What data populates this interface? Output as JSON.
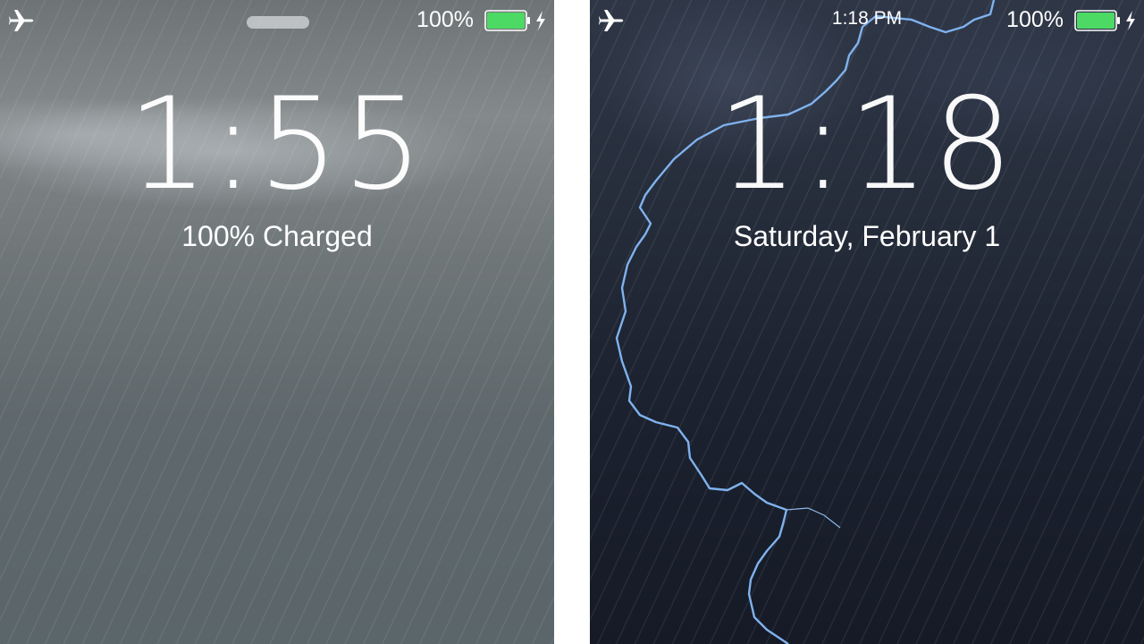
{
  "left_screen": {
    "status": {
      "airplane_icon": "airplane-icon",
      "battery_percent": "100%",
      "battery_level": 1.0,
      "charging_icon": "bolt-icon"
    },
    "time": "1:55",
    "subtitle": "100% Charged"
  },
  "right_screen": {
    "status": {
      "airplane_icon": "airplane-icon",
      "clock": "1:18 PM",
      "battery_percent": "100%",
      "battery_level": 1.0,
      "charging_icon": "bolt-icon"
    },
    "time": "1:18",
    "subtitle": "Saturday, February 1"
  },
  "colors": {
    "battery_fill": "#4cd964",
    "lightning": "#7fb2ee"
  }
}
